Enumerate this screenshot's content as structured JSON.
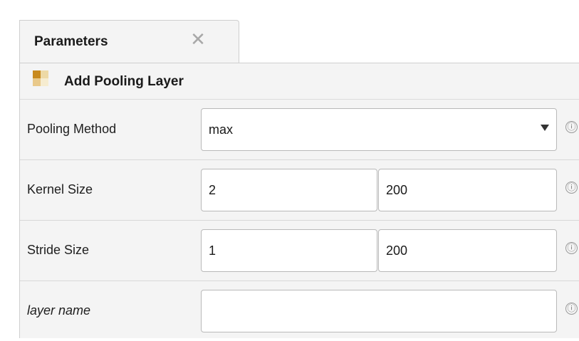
{
  "tab": {
    "label": "Parameters",
    "close_glyph": "✕"
  },
  "section": {
    "icon": "pooling-layer-icon",
    "title": "Add Pooling Layer"
  },
  "rows": {
    "pooling_method": {
      "label": "Pooling Method",
      "value": "max",
      "info": "ⓘ"
    },
    "kernel_size": {
      "label": "Kernel Size",
      "value1": "2",
      "value2": "200",
      "info": "ⓘ"
    },
    "stride_size": {
      "label": "Stride Size",
      "value1": "1",
      "value2": "200",
      "info": "ⓘ"
    },
    "layer_name": {
      "label": "layer name",
      "value": "",
      "info": "ⓘ"
    }
  }
}
